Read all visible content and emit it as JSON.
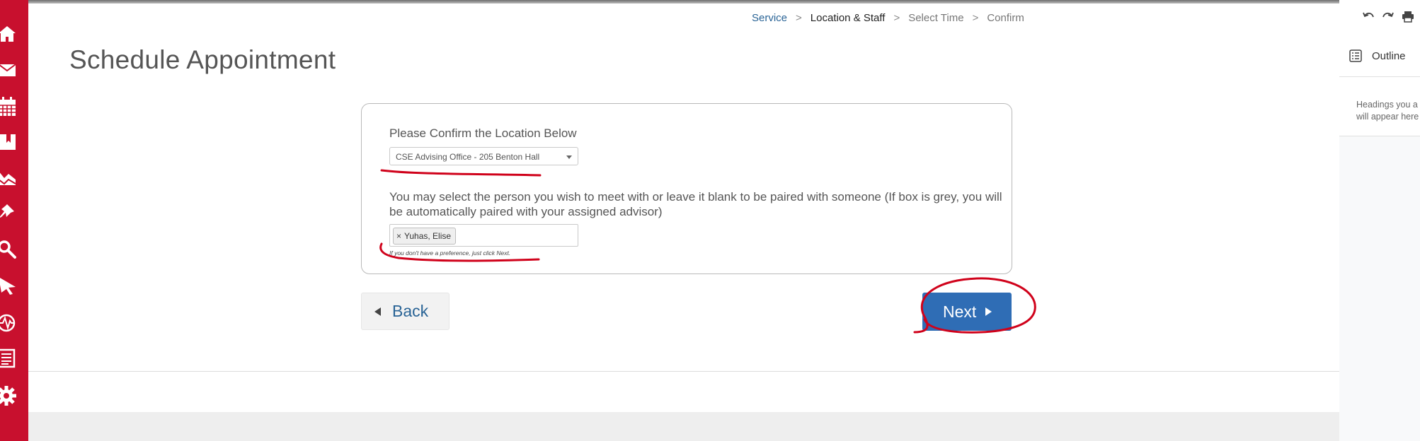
{
  "breadcrumb": {
    "items": [
      {
        "label": "Service"
      },
      {
        "label": "Location & Staff"
      },
      {
        "label": "Select Time"
      },
      {
        "label": "Confirm"
      }
    ],
    "separator": ">"
  },
  "page": {
    "title": "Schedule Appointment"
  },
  "form": {
    "location_label": "Please Confirm the Location Below",
    "location_selected": "CSE Advising Office - 205 Benton Hall",
    "staff_label": "You may select the person you wish to meet with or leave it blank to be paired with someone (If box is grey, you will be automatically paired with your assigned advisor)",
    "staff_tag": "Yuhas, Elise",
    "staff_tag_remove": "×",
    "hint": "If you don't have a preference, just click Next."
  },
  "buttons": {
    "back": "Back",
    "next": "Next"
  },
  "right_panel": {
    "outline_title": "Outline",
    "desc_line1": "Headings you a",
    "desc_line2": "will appear here"
  },
  "sidebar": {
    "icons": [
      "home-icon",
      "mail-icon",
      "calendar-icon",
      "book-icon",
      "chart-icon",
      "pin-icon",
      "search-icon",
      "cursor-icon",
      "activity-icon",
      "news-icon",
      "gear-icon"
    ]
  },
  "colors": {
    "sidebar": "#c8102e",
    "primary_button": "#2f6db5",
    "link": "#2a6496",
    "annotation": "#d0021b"
  }
}
